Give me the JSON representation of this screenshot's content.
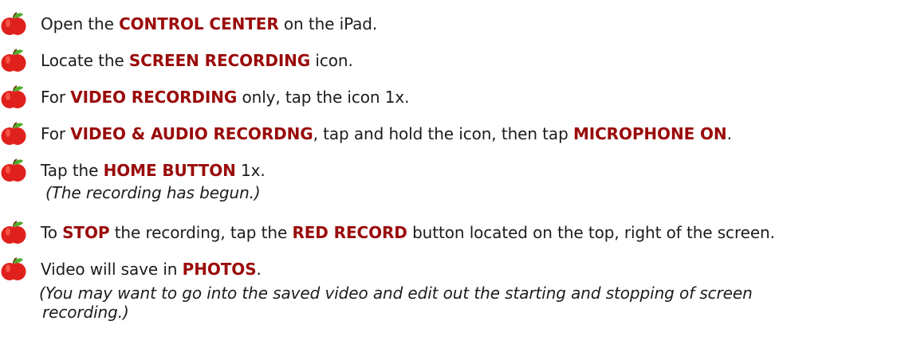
{
  "icon": "red-apple-icon",
  "colors": {
    "emphasis": "#9a0a0a",
    "text": "#1c1c1c",
    "apple_red": "#e0201c",
    "apple_leaf": "#4fae2a"
  },
  "steps": [
    {
      "parts": [
        {
          "text": "Open the "
        },
        {
          "text": "CONTROL CENTER",
          "em": true
        },
        {
          "text": " on the iPad."
        }
      ]
    },
    {
      "parts": [
        {
          "text": "Locate the "
        },
        {
          "text": "SCREEN RECORDING",
          "em": true
        },
        {
          "text": " icon."
        }
      ]
    },
    {
      "parts": [
        {
          "text": "For "
        },
        {
          "text": "VIDEO RECORDING",
          "em": true
        },
        {
          "text": " only, tap the icon 1x."
        }
      ]
    },
    {
      "parts": [
        {
          "text": "For "
        },
        {
          "text": "VIDEO & AUDIO RECORDNG",
          "em": true
        },
        {
          "text": ", tap and hold the icon, then tap "
        },
        {
          "text": "MICROPHONE ON",
          "em": true
        },
        {
          "text": "."
        }
      ]
    },
    {
      "parts": [
        {
          "text": "Tap the "
        },
        {
          "text": "HOME BUTTON",
          "em": true
        },
        {
          "text": " 1x."
        }
      ],
      "note": "(The recording has begun.)"
    },
    {
      "parts": [
        {
          "text": "To "
        },
        {
          "text": "STOP",
          "em": true
        },
        {
          "text": " the recording, tap the "
        },
        {
          "text": "RED RECORD",
          "em": true
        },
        {
          "text": " button located on the top, right of the screen."
        }
      ]
    },
    {
      "parts": [
        {
          "text": "Video will save in "
        },
        {
          "text": "PHOTOS",
          "em": true
        },
        {
          "text": "."
        }
      ],
      "note_lines": [
        "(You may want to go into the saved video and edit out the starting and stopping of screen",
        "recording.)"
      ]
    }
  ]
}
